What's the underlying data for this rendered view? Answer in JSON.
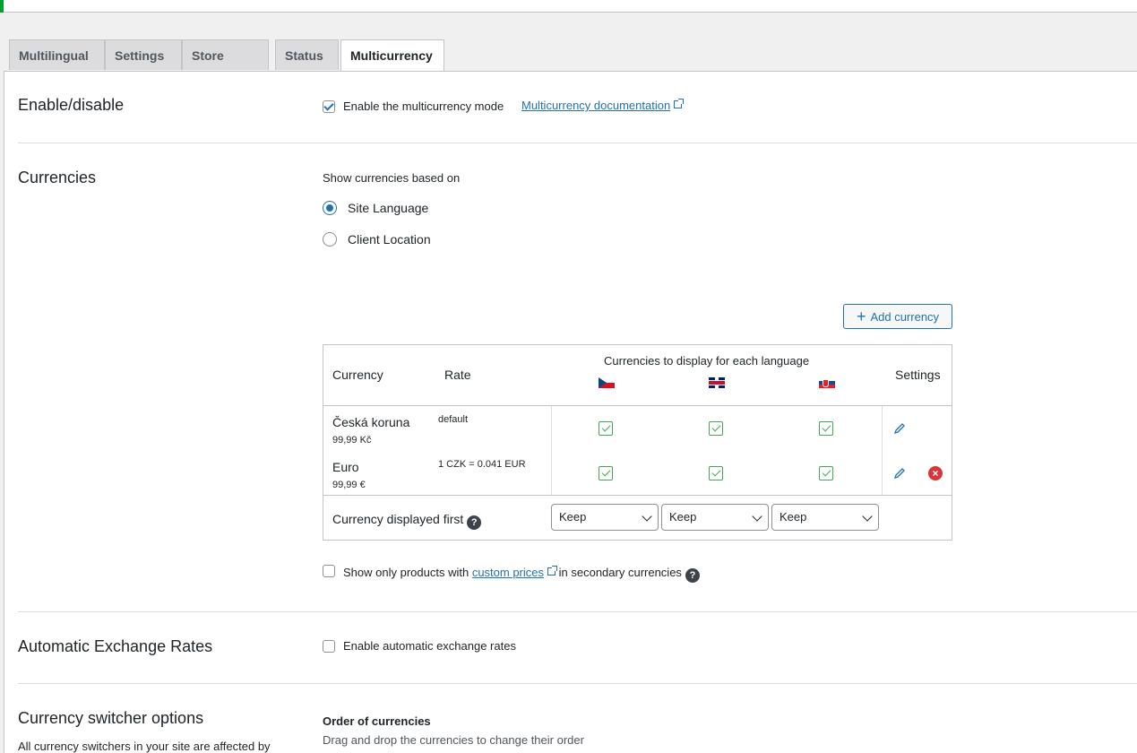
{
  "tabs": [
    {
      "label": "Multilingual"
    },
    {
      "label": "Settings"
    },
    {
      "label": "Store URLs"
    },
    {
      "label": "Status"
    },
    {
      "label": "Multicurrency"
    }
  ],
  "enable_section": {
    "title": "Enable/disable",
    "checkbox_label": "Enable the multicurrency mode",
    "checked": true,
    "doc_link": "Multicurrency documentation"
  },
  "currencies_section": {
    "title": "Currencies",
    "show_based_on": "Show currencies based on",
    "options": [
      {
        "label": "Site Language",
        "selected": true
      },
      {
        "label": "Client Location",
        "selected": false
      }
    ],
    "add_button": "Add currency",
    "table": {
      "col_currency": "Currency",
      "col_rate": "Rate",
      "col_languages": "Currencies to display for each language",
      "col_settings": "Settings",
      "languages": [
        "cz-flag",
        "gb-flag",
        "sk-flag"
      ],
      "rows": [
        {
          "name": "Česká koruna",
          "price": "99,99 Kč",
          "rate": "default"
        },
        {
          "name": "Euro",
          "price": "99,99 €",
          "rate": "1 CZK = 0.041 EUR"
        }
      ],
      "displayed_first_label": "Currency displayed first",
      "displayed_first_options": [
        "Keep",
        "Keep",
        "Keep"
      ]
    },
    "products_checkbox": {
      "prefix": "Show only products with",
      "link": "custom prices",
      "suffix": "in secondary currencies"
    }
  },
  "auto_rates_section": {
    "title": "Automatic Exchange Rates",
    "checkbox_label": "Enable automatic exchange rates"
  },
  "switcher_section": {
    "title": "Currency switcher options",
    "partial_text": "All currency switchers in your site are affected by",
    "order_title": "Order of currencies",
    "order_desc": "Drag and drop the currencies to change their order"
  },
  "colors": {
    "accent": "#2271b1",
    "success": "#00a32a",
    "danger": "#d63638"
  }
}
